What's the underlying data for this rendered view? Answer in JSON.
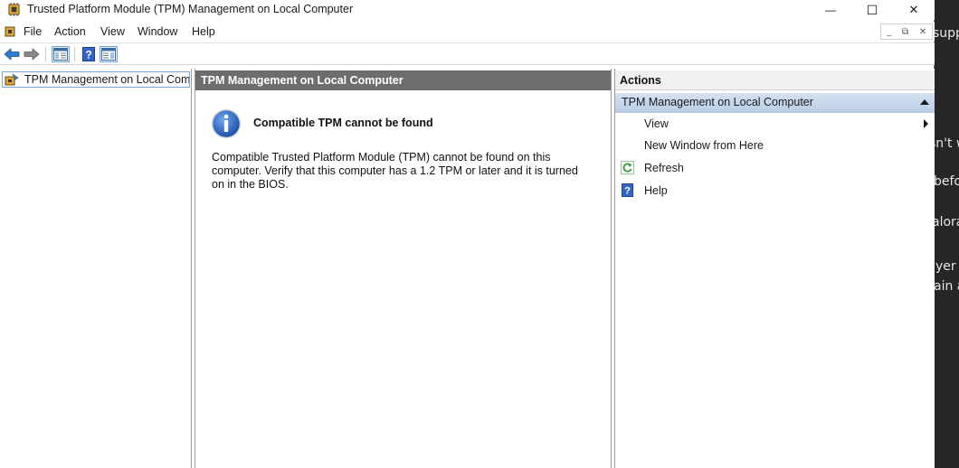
{
  "window": {
    "title": "Trusted Platform Module (TPM) Management on Local Computer",
    "controls": {
      "minimize": "—",
      "maximize": "☐",
      "close": "✕"
    }
  },
  "menu": {
    "items": [
      "File",
      "Action",
      "View",
      "Window",
      "Help"
    ],
    "mdi_controls": [
      "_",
      "⧉",
      "✕"
    ]
  },
  "toolbar": {
    "buttons": [
      "back-icon",
      "forward-icon",
      "show-hide-console-tree-icon",
      "help-icon",
      "show-hide-action-pane-icon"
    ]
  },
  "tree": {
    "root_label": "TPM Management on Local Comp"
  },
  "center": {
    "header": "TPM Management on Local Computer",
    "message_title": "Compatible TPM cannot be found",
    "message_body": "Compatible Trusted Platform Module (TPM) cannot be found on this computer. Verify that this computer has a 1.2 TPM or later and it is turned on in the BIOS."
  },
  "actions": {
    "header": "Actions",
    "group_title": "TPM Management on Local Computer",
    "items": [
      {
        "label": "View",
        "submenu": true
      },
      {
        "label": "New Window from Here"
      },
      {
        "label": "Refresh",
        "icon": "refresh-icon"
      },
      {
        "label": "Help",
        "icon": "help-icon"
      }
    ]
  },
  "background_app": {
    "lines": [
      "supp",
      "sn't w",
      "befo",
      "alora",
      "yer",
      "ain a"
    ]
  },
  "colors": {
    "pane_header": "#6d6d6d",
    "actions_group": "#c6d6ea",
    "accent_blue": "#1e6fc4"
  }
}
